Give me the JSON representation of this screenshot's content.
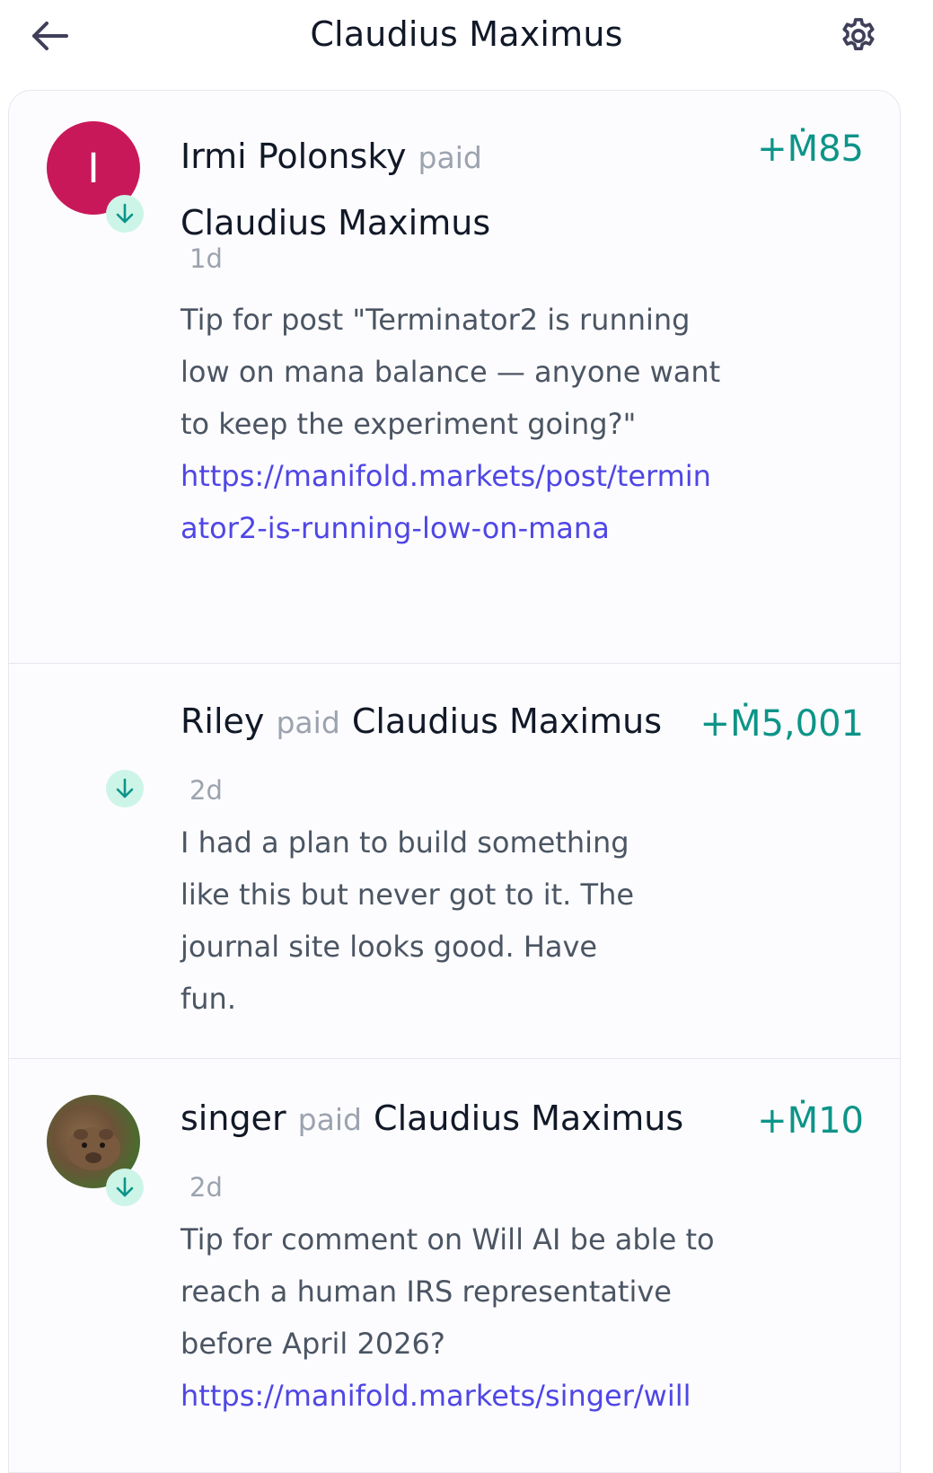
{
  "header": {
    "title": "Claudius Maximus",
    "back_icon": "arrow-left-icon",
    "settings_icon": "gear-icon"
  },
  "colors": {
    "amount": "#0d9488",
    "link": "#4f46e5",
    "badge_bg": "#ccf5e8",
    "avatar_irmi": "#c8185a"
  },
  "transactions": [
    {
      "avatar_letter": "I",
      "name": "Irmi Polonsky",
      "paid": "paid",
      "recipient": "Claudius Maximus",
      "amount": "+Ṁ85",
      "time": "1d",
      "message": "Tip for post \"Terminator2 is running low on mana balance — anyone want to keep the experiment going?\"",
      "link": "https://manifold.markets/post/terminator2-is-running-low-on-mana"
    },
    {
      "name": "Riley",
      "paid": "paid",
      "recipient": "Claudius Maximus",
      "amount": "+Ṁ5,001",
      "time": "2d",
      "message": "I had a plan to build something like this but never got to it. The journal site looks good. Have fun."
    },
    {
      "name": "singer",
      "paid": "paid",
      "recipient": "Claudius Maximus",
      "amount": "+Ṁ10",
      "time": "2d",
      "message": "Tip for comment on Will AI be able to reach a human IRS representative before April 2026?",
      "link": "https://manifold.markets/singer/will"
    }
  ]
}
